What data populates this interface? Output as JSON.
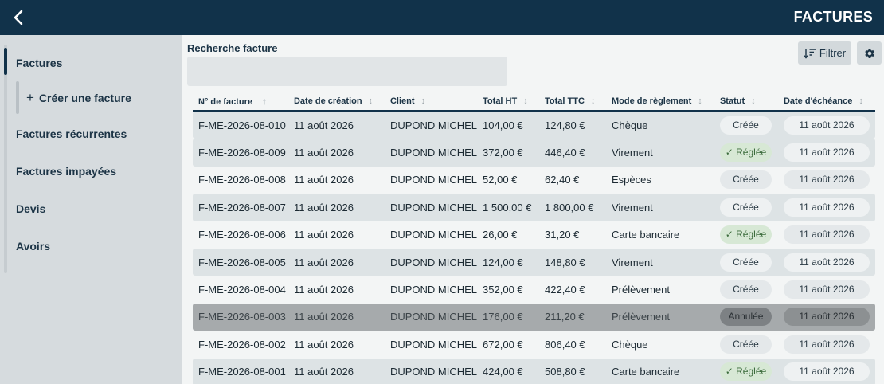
{
  "app": {
    "title": "FACTURES"
  },
  "sidebar": {
    "items": [
      {
        "label": "Factures"
      },
      {
        "label": "Créer une facture"
      },
      {
        "label": "Factures récurrentes"
      },
      {
        "label": "Factures impayées"
      },
      {
        "label": "Devis"
      },
      {
        "label": "Avoirs"
      }
    ]
  },
  "search": {
    "label": "Recherche facture",
    "value": "",
    "placeholder": ""
  },
  "toolbar": {
    "filter_label": "Filtrer"
  },
  "table": {
    "columns": [
      "N° de facture",
      "Date de création",
      "Client",
      "Total HT",
      "Total TTC",
      "Mode de règlement",
      "Statut",
      "Date d'échéance"
    ],
    "rows": [
      {
        "number": "F-ME-2026-08-010",
        "created": "11 août 2026",
        "client": "DUPOND MICHEL",
        "total_ht": "104,00 €",
        "total_ttc": "124,80 €",
        "payment": "Chèque",
        "status": "Créée",
        "due": "11 août 2026"
      },
      {
        "number": "F-ME-2026-08-009",
        "created": "11 août 2026",
        "client": "DUPOND MICHEL",
        "total_ht": "372,00 €",
        "total_ttc": "446,40 €",
        "payment": "Virement",
        "status": "Réglée",
        "due": "11 août 2026"
      },
      {
        "number": "F-ME-2026-08-008",
        "created": "11 août 2026",
        "client": "DUPOND MICHEL",
        "total_ht": "52,00 €",
        "total_ttc": "62,40 €",
        "payment": "Espèces",
        "status": "Créée",
        "due": "11 août 2026"
      },
      {
        "number": "F-ME-2026-08-007",
        "created": "11 août 2026",
        "client": "DUPOND MICHEL",
        "total_ht": "1 500,00 €",
        "total_ttc": "1 800,00 €",
        "payment": "Virement",
        "status": "Créée",
        "due": "11 août 2026"
      },
      {
        "number": "F-ME-2026-08-006",
        "created": "11 août 2026",
        "client": "DUPOND MICHEL",
        "total_ht": "26,00 €",
        "total_ttc": "31,20 €",
        "payment": "Carte bancaire",
        "status": "Réglée",
        "due": "11 août 2026"
      },
      {
        "number": "F-ME-2026-08-005",
        "created": "11 août 2026",
        "client": "DUPOND MICHEL",
        "total_ht": "124,00 €",
        "total_ttc": "148,80 €",
        "payment": "Virement",
        "status": "Créée",
        "due": "11 août 2026"
      },
      {
        "number": "F-ME-2026-08-004",
        "created": "11 août 2026",
        "client": "DUPOND MICHEL",
        "total_ht": "352,00 €",
        "total_ttc": "422,40 €",
        "payment": "Prélèvement",
        "status": "Créée",
        "due": "11 août 2026"
      },
      {
        "number": "F-ME-2026-08-003",
        "created": "11 août 2026",
        "client": "DUPOND MICHEL",
        "total_ht": "176,00 €",
        "total_ttc": "211,20 €",
        "payment": "Prélèvement",
        "status": "Annulée",
        "due": "11 août 2026"
      },
      {
        "number": "F-ME-2026-08-002",
        "created": "11 août 2026",
        "client": "DUPOND MICHEL",
        "total_ht": "672,00 €",
        "total_ttc": "806,40 €",
        "payment": "Chèque",
        "status": "Créée",
        "due": "11 août 2026"
      },
      {
        "number": "F-ME-2026-08-001",
        "created": "11 août 2026",
        "client": "DUPOND MICHEL",
        "total_ht": "424,00 €",
        "total_ttc": "508,80 €",
        "payment": "Carte bancaire",
        "status": "Réglée",
        "due": "11 août 2026"
      }
    ]
  },
  "icons": {
    "back": "chevron-left-icon",
    "filter": "sort-filter-icon",
    "settings": "gear-icon",
    "sort": "sort-arrow-icon",
    "paid": "checkmark-icon"
  },
  "colors": {
    "header_bg": "#11324a",
    "sidebar_bg": "#d6dbde",
    "row_alt": "#dde3e5",
    "row_cancelled": "#a6aaac",
    "paid_pill": "#d7e8d5"
  }
}
